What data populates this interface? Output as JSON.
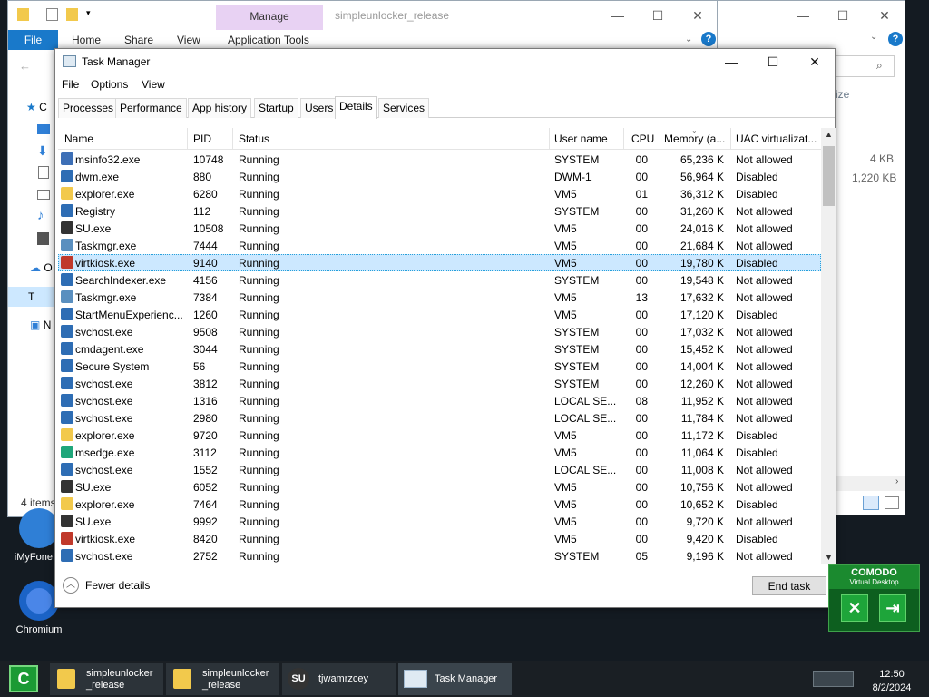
{
  "explorer": {
    "ribbon_tabs": [
      "File",
      "Home",
      "Share",
      "View",
      "Application Tools"
    ],
    "manage_label": "Manage",
    "window_title": "simpleunlocker_release",
    "status": "4 items",
    "sizes": [
      "4 KB",
      "1,220 KB"
    ],
    "size_header": "ize",
    "sidebar_partial": [
      "C",
      "O",
      "T",
      "N"
    ]
  },
  "desktop_icons": [
    {
      "label": "iMyFone Fi",
      "color": "#2f7fd6"
    },
    {
      "label": "Chromium",
      "color": "#4a86e8"
    }
  ],
  "taskmgr": {
    "title": "Task Manager",
    "menu": [
      "File",
      "Options",
      "View"
    ],
    "tabs": [
      "Processes",
      "Performance",
      "App history",
      "Startup",
      "Users",
      "Details",
      "Services"
    ],
    "active_tab": "Details",
    "columns": [
      "Name",
      "PID",
      "Status",
      "User name",
      "CPU",
      "Memory (a...",
      "UAC virtualizat..."
    ],
    "rows": [
      {
        "name": "msinfo32.exe",
        "pid": "10748",
        "status": "Running",
        "user": "SYSTEM",
        "cpu": "00",
        "mem": "65,236 K",
        "uac": "Not allowed",
        "icon": "#3d6fb6"
      },
      {
        "name": "dwm.exe",
        "pid": "880",
        "status": "Running",
        "user": "DWM-1",
        "cpu": "00",
        "mem": "56,964 K",
        "uac": "Disabled",
        "icon": "#2e6db4"
      },
      {
        "name": "explorer.exe",
        "pid": "6280",
        "status": "Running",
        "user": "VM5",
        "cpu": "01",
        "mem": "36,312 K",
        "uac": "Disabled",
        "icon": "#f2c94c"
      },
      {
        "name": "Registry",
        "pid": "112",
        "status": "Running",
        "user": "SYSTEM",
        "cpu": "00",
        "mem": "31,260 K",
        "uac": "Not allowed",
        "icon": "#2e6db4"
      },
      {
        "name": "SU.exe",
        "pid": "10508",
        "status": "Running",
        "user": "VM5",
        "cpu": "00",
        "mem": "24,016 K",
        "uac": "Not allowed",
        "icon": "#333333"
      },
      {
        "name": "Taskmgr.exe",
        "pid": "7444",
        "status": "Running",
        "user": "VM5",
        "cpu": "00",
        "mem": "21,684 K",
        "uac": "Not allowed",
        "icon": "#5a8fbf"
      },
      {
        "name": "virtkiosk.exe",
        "pid": "9140",
        "status": "Running",
        "user": "VM5",
        "cpu": "00",
        "mem": "19,780 K",
        "uac": "Disabled",
        "icon": "#c0392b",
        "selected": true
      },
      {
        "name": "SearchIndexer.exe",
        "pid": "4156",
        "status": "Running",
        "user": "SYSTEM",
        "cpu": "00",
        "mem": "19,548 K",
        "uac": "Not allowed",
        "icon": "#2e6db4"
      },
      {
        "name": "Taskmgr.exe",
        "pid": "7384",
        "status": "Running",
        "user": "VM5",
        "cpu": "13",
        "mem": "17,632 K",
        "uac": "Not allowed",
        "icon": "#5a8fbf"
      },
      {
        "name": "StartMenuExperienc...",
        "pid": "1260",
        "status": "Running",
        "user": "VM5",
        "cpu": "00",
        "mem": "17,120 K",
        "uac": "Disabled",
        "icon": "#2e6db4"
      },
      {
        "name": "svchost.exe",
        "pid": "9508",
        "status": "Running",
        "user": "SYSTEM",
        "cpu": "00",
        "mem": "17,032 K",
        "uac": "Not allowed",
        "icon": "#2e6db4"
      },
      {
        "name": "cmdagent.exe",
        "pid": "3044",
        "status": "Running",
        "user": "SYSTEM",
        "cpu": "00",
        "mem": "15,452 K",
        "uac": "Not allowed",
        "icon": "#2e6db4"
      },
      {
        "name": "Secure System",
        "pid": "56",
        "status": "Running",
        "user": "SYSTEM",
        "cpu": "00",
        "mem": "14,004 K",
        "uac": "Not allowed",
        "icon": "#2e6db4"
      },
      {
        "name": "svchost.exe",
        "pid": "3812",
        "status": "Running",
        "user": "SYSTEM",
        "cpu": "00",
        "mem": "12,260 K",
        "uac": "Not allowed",
        "icon": "#2e6db4"
      },
      {
        "name": "svchost.exe",
        "pid": "1316",
        "status": "Running",
        "user": "LOCAL SE...",
        "cpu": "08",
        "mem": "11,952 K",
        "uac": "Not allowed",
        "icon": "#2e6db4"
      },
      {
        "name": "svchost.exe",
        "pid": "2980",
        "status": "Running",
        "user": "LOCAL SE...",
        "cpu": "00",
        "mem": "11,784 K",
        "uac": "Not allowed",
        "icon": "#2e6db4"
      },
      {
        "name": "explorer.exe",
        "pid": "9720",
        "status": "Running",
        "user": "VM5",
        "cpu": "00",
        "mem": "11,172 K",
        "uac": "Disabled",
        "icon": "#f2c94c"
      },
      {
        "name": "msedge.exe",
        "pid": "3112",
        "status": "Running",
        "user": "VM5",
        "cpu": "00",
        "mem": "11,064 K",
        "uac": "Disabled",
        "icon": "#1fa67a"
      },
      {
        "name": "svchost.exe",
        "pid": "1552",
        "status": "Running",
        "user": "LOCAL SE...",
        "cpu": "00",
        "mem": "11,008 K",
        "uac": "Not allowed",
        "icon": "#2e6db4"
      },
      {
        "name": "SU.exe",
        "pid": "6052",
        "status": "Running",
        "user": "VM5",
        "cpu": "00",
        "mem": "10,756 K",
        "uac": "Not allowed",
        "icon": "#333333"
      },
      {
        "name": "explorer.exe",
        "pid": "7464",
        "status": "Running",
        "user": "VM5",
        "cpu": "00",
        "mem": "10,652 K",
        "uac": "Disabled",
        "icon": "#f2c94c"
      },
      {
        "name": "SU.exe",
        "pid": "9992",
        "status": "Running",
        "user": "VM5",
        "cpu": "00",
        "mem": "9,720 K",
        "uac": "Not allowed",
        "icon": "#333333"
      },
      {
        "name": "virtkiosk.exe",
        "pid": "8420",
        "status": "Running",
        "user": "VM5",
        "cpu": "00",
        "mem": "9,420 K",
        "uac": "Disabled",
        "icon": "#c0392b"
      },
      {
        "name": "svchost.exe",
        "pid": "2752",
        "status": "Running",
        "user": "SYSTEM",
        "cpu": "05",
        "mem": "9,196 K",
        "uac": "Not allowed",
        "icon": "#2e6db4"
      }
    ],
    "fewer_details": "Fewer details",
    "end_task": "End task"
  },
  "comodo": {
    "title": "COMODO",
    "subtitle": "Virtual Desktop"
  },
  "taskbar": {
    "items": [
      {
        "label": "simpleunlocker\n_release"
      },
      {
        "label": "simpleunlocker\n_release"
      },
      {
        "label": "tjwamrzcey"
      },
      {
        "label": "Task Manager"
      }
    ],
    "time": "12:50",
    "date": "8/2/2024"
  }
}
